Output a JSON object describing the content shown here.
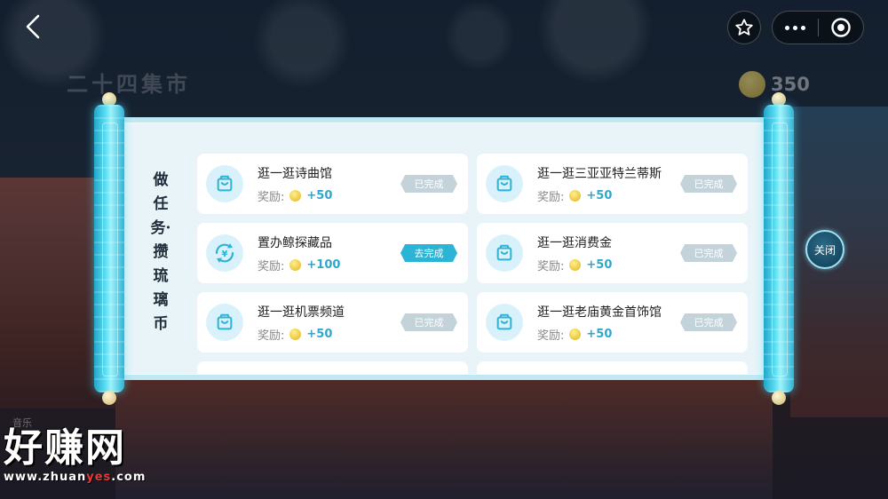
{
  "background": {
    "market_title": "二十四集市",
    "coin_count": "350",
    "music_label": "音乐"
  },
  "nav": {
    "back_icon": "chevron-left-icon",
    "star_icon": "star-icon",
    "more_icon": "more-dots-icon",
    "target_icon": "record-target-icon"
  },
  "scroll": {
    "heading": "做任务·攒琉璃币",
    "reward_label": "奖励:",
    "tasks": [
      {
        "title": "逛一逛诗曲馆",
        "reward": "+50",
        "status": "已完成",
        "icon": "bag-icon"
      },
      {
        "title": "逛一逛三亚亚特兰蒂斯",
        "reward": "+50",
        "status": "已完成",
        "icon": "bag-icon"
      },
      {
        "title": "置办鲸探藏品",
        "reward": "+100",
        "status": "去完成",
        "icon": "yuan-exchange-icon"
      },
      {
        "title": "逛一逛消费金",
        "reward": "+50",
        "status": "已完成",
        "icon": "bag-icon"
      },
      {
        "title": "逛一逛机票频道",
        "reward": "+50",
        "status": "已完成",
        "icon": "bag-icon"
      },
      {
        "title": "逛一逛老庙黄金首饰馆",
        "reward": "+50",
        "status": "已完成",
        "icon": "bag-icon"
      }
    ]
  },
  "close_label": "关闭",
  "watermark": {
    "logo": "好赚网",
    "url_prefix": "www.zhuan",
    "url_highlight": "yes",
    "url_suffix": ".com"
  },
  "colors": {
    "accent": "#2cb4d6",
    "done_button": "#c4d3d9",
    "reward_text": "#2fa7cc"
  }
}
